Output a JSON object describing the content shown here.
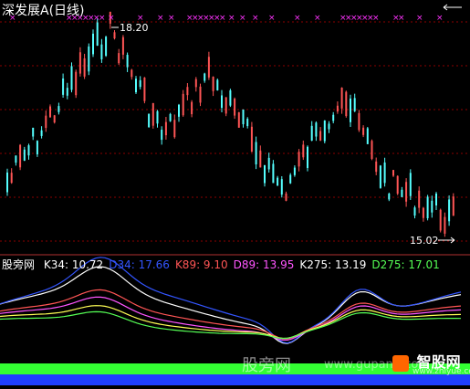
{
  "title": "深发展A(日线)",
  "max_label": "18.20",
  "min_label": "15.02",
  "colors": {
    "up": "#ff5555",
    "down": "#55ffff",
    "marker": "#ff33ff",
    "grid": "#8b0000",
    "k34": "#ffffff",
    "d34": "#3355ff",
    "k89": "#ff5555",
    "d89": "#ff55ff",
    "k275": "#ffffff",
    "d275": "#55ff55",
    "band_green": "#33ff33",
    "band_blue": "#1f3fff"
  },
  "indicator": {
    "name": "股旁网",
    "items": [
      {
        "label": "K34",
        "value": "10.72",
        "color": "#ffffff"
      },
      {
        "label": "D34",
        "value": "17.66",
        "color": "#3355ff"
      },
      {
        "label": "K89",
        "value": "9.10",
        "color": "#ff5555"
      },
      {
        "label": "D89",
        "value": "13.95",
        "color": "#ff55ff"
      },
      {
        "label": "K275",
        "value": "13.19",
        "color": "#ffffff"
      },
      {
        "label": "D275",
        "value": "17.01",
        "color": "#55ff55"
      }
    ]
  },
  "watermark": {
    "left": "股旁网",
    "url": "www.gupang.com",
    "logo": "智股网",
    "logo_url": "www.zhiyue.com"
  }
}
